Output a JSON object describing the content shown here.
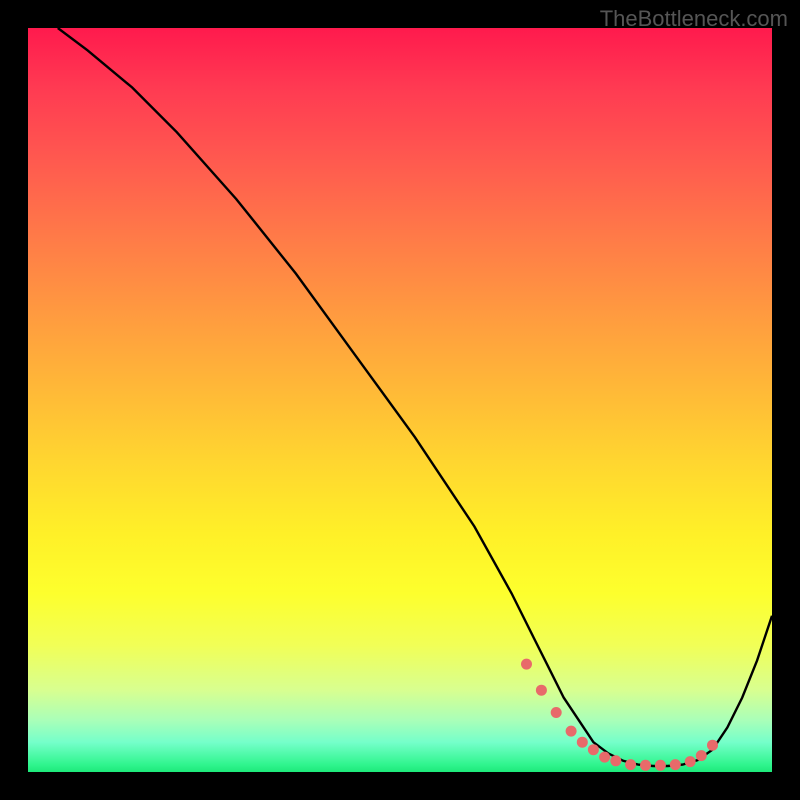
{
  "watermark": "TheBottleneck.com",
  "chart_data": {
    "type": "line",
    "title": "",
    "xlabel": "",
    "ylabel": "",
    "xlim": [
      0,
      100
    ],
    "ylim": [
      0,
      100
    ],
    "series": [
      {
        "name": "bottleneck-curve",
        "x": [
          4,
          8,
          14,
          20,
          28,
          36,
          44,
          52,
          60,
          65,
          68,
          70,
          72,
          74,
          76,
          78,
          80,
          82,
          84,
          86,
          88,
          90,
          92,
          94,
          96,
          98,
          100
        ],
        "y": [
          100,
          97,
          92,
          86,
          77,
          67,
          56,
          45,
          33,
          24,
          18,
          14,
          10,
          7,
          4,
          2.5,
          1.5,
          1,
          0.8,
          0.8,
          1,
          1.6,
          3,
          6,
          10,
          15,
          21
        ]
      }
    ],
    "markers": {
      "name": "optimal-range-dots",
      "x": [
        67,
        69,
        71,
        73,
        74.5,
        76,
        77.5,
        79,
        81,
        83,
        85,
        87,
        89,
        90.5,
        92
      ],
      "y": [
        14.5,
        11,
        8,
        5.5,
        4,
        3,
        2,
        1.5,
        1,
        0.9,
        0.9,
        1,
        1.4,
        2.2,
        3.6
      ]
    }
  }
}
